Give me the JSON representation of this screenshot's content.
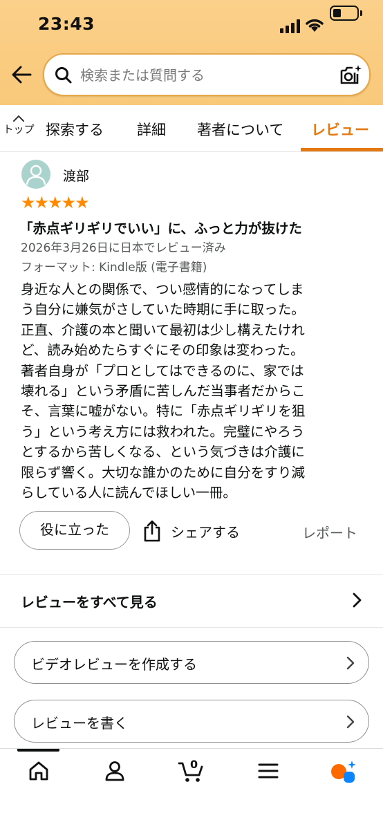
{
  "status_bar": {
    "time": "23:43"
  },
  "search": {
    "placeholder": "検索または質問する"
  },
  "tabs": {
    "top_label": "トップ",
    "items": [
      {
        "label": "探索する"
      },
      {
        "label": "詳細"
      },
      {
        "label": "著者について"
      },
      {
        "label": "レビュー"
      }
    ],
    "active_index": 3
  },
  "review": {
    "reviewer_name": "渡部",
    "rating": 5,
    "stars_text": "★★★★★",
    "title": "「赤点ギリギリでいい」に、ふっと力が抜けた",
    "date_line": "2026年3月26日に日本でレビュー済み",
    "format_line": "フォーマット: Kindle版 (電子書籍)",
    "body_lines": [
      "身近な人との関係で、つい感情的になってしま",
      "う自分に嫌気がさしていた時期に手に取った。",
      "正直、介護の本と聞いて最初は少し構えたけれ",
      "ど、読み始めたらすぐにその印象は変わった。",
      "著者自身が「プロとしてはできるのに、家では",
      "壊れる」という矛盾に苦しんだ当事者だからこ",
      "そ、言葉に嘘がない。特に「赤点ギリギリを狙",
      "う」という考え方には救われた。完璧にやろう",
      "とするから苦しくなる、という気づきは介護に",
      "限らず響く。大切な誰かのために自分をすり減",
      "らしている人に読んでほしい一冊。"
    ],
    "helpful_label": "役に立った",
    "share_label": "シェアする",
    "report_label": "レポート"
  },
  "links": {
    "see_all_label": "レビューをすべて見る",
    "video_review_label": "ビデオレビューを作成する",
    "write_review_label": "レビューを書く"
  },
  "bottom_nav": {
    "items": [
      "home-icon",
      "account-icon",
      "cart-icon",
      "menu-icon",
      "rufus-icon"
    ],
    "cart_count": "0"
  },
  "colors": {
    "header_bg": "#f9c97a",
    "accent": "#e47911",
    "star": "#ff8a00"
  }
}
